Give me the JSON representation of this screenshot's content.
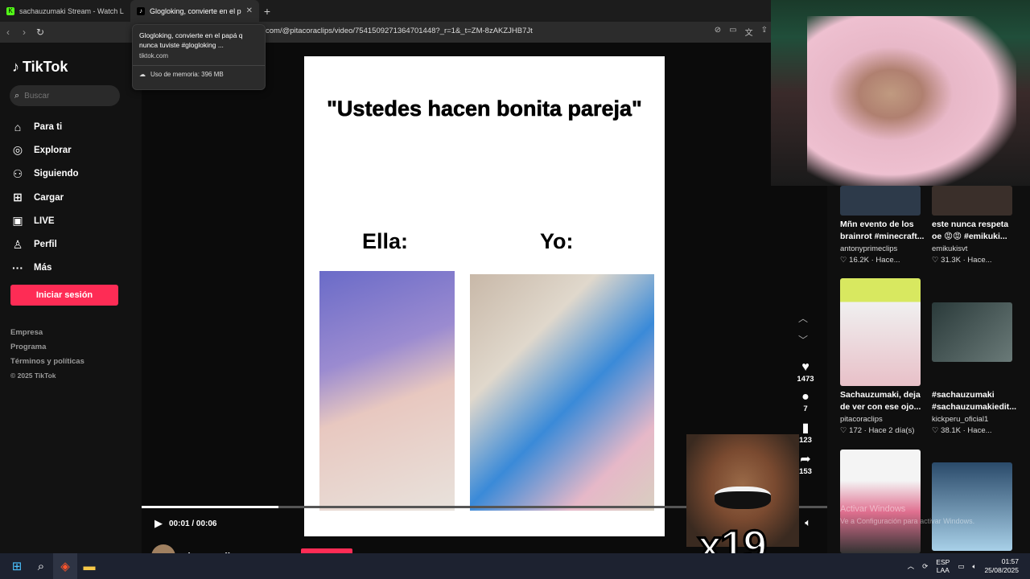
{
  "browser": {
    "tabs": [
      {
        "title": "sachauzumaki Stream - Watch Live o",
        "icon": "kick-icon",
        "color": "#53fc18"
      },
      {
        "title": "Glogloking, convierte en el papá",
        "icon": "tiktok-icon"
      }
    ],
    "url": "com/@pitacoraclips/video/7541509271364701448?_r=1&_t=ZM-8zAKZJHB7Jt",
    "tooltip": {
      "title": "Glogloking, convierte en el papá q nunca tuviste #glogloking ...",
      "domain": "tiktok.com",
      "memory": "Uso de memoria: 396 MB"
    }
  },
  "sidebar": {
    "brand": "TikTok",
    "search_placeholder": "Buscar",
    "menu": [
      {
        "label": "Para ti",
        "icon": "home-icon"
      },
      {
        "label": "Explorar",
        "icon": "compass-icon"
      },
      {
        "label": "Siguiendo",
        "icon": "following-icon"
      },
      {
        "label": "Cargar",
        "icon": "upload-icon"
      },
      {
        "label": "LIVE",
        "icon": "live-icon"
      },
      {
        "label": "Perfil",
        "icon": "profile-icon"
      },
      {
        "label": "Más",
        "icon": "more-icon"
      }
    ],
    "login_label": "Iniciar sesión",
    "footer": [
      "Empresa",
      "Programa",
      "Términos y políticas"
    ],
    "copyright": "© 2025 TikTok",
    "accent": "#fe2c55"
  },
  "video": {
    "caption": "\"Ustedes hacen bonita pareja\"",
    "label_left": "Ella:",
    "label_right": "Yo:",
    "time": "00:01 / 00:06",
    "progress": 0.2,
    "channel": "pitacoraclips"
  },
  "actions": {
    "likes": "1473",
    "comments": "7",
    "saves": "123",
    "shares": "153"
  },
  "recommendations": [
    {
      "title": "Mñn evento de los brainrot #minecraft...",
      "user": "antonyprimeclips",
      "meta": "♡ 16.2K · Hace..."
    },
    {
      "title": "este nunca respeta oe 😡😡 #emikuki...",
      "user": "emikukisvt",
      "meta": "♡ 31.3K · Hace..."
    },
    {
      "title": "Sachauzumaki, deja de ver con ese ojo...",
      "user": "pitacoraclips",
      "meta": "♡ 172 · Hace 2 día(s)"
    },
    {
      "title": "#sachauzumaki #sachauzumakiedit...",
      "user": "kickperu_oficial1",
      "meta": "♡ 38.1K · Hace..."
    }
  ],
  "overlay": {
    "multiplier": "x19",
    "watermark_line1": "Activar Windows",
    "watermark_line2": "Ve a Configuración para activar Windows."
  },
  "taskbar": {
    "lang": "ESP",
    "region": "LAA",
    "time": "01:57",
    "date": "25/08/2025"
  }
}
